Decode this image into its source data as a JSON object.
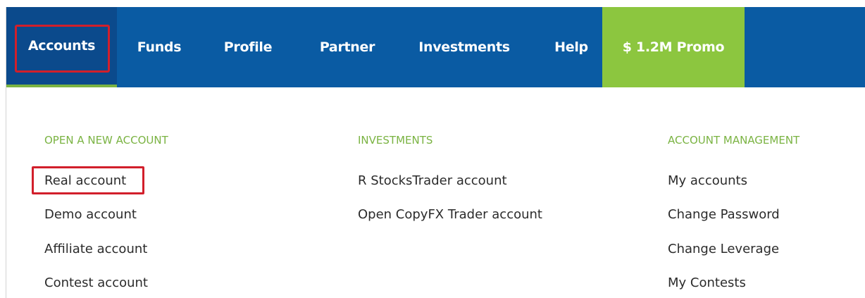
{
  "nav": {
    "items": [
      {
        "label": "Accounts"
      },
      {
        "label": "Funds"
      },
      {
        "label": "Profile"
      },
      {
        "label": "Partner"
      },
      {
        "label": "Investments"
      },
      {
        "label": "Help"
      },
      {
        "label": "$ 1.2M Promo"
      }
    ],
    "active": "Accounts",
    "colors": {
      "bar": "#0a5ba3",
      "active_bg": "#0b4a8c",
      "promo_bg": "#8cc63f",
      "accent": "#7ab342",
      "highlight": "#d21f2b"
    }
  },
  "dropdown": {
    "columns": [
      {
        "heading": "OPEN A NEW ACCOUNT",
        "links": [
          "Real account",
          "Demo account",
          "Affiliate account",
          "Contest account"
        ]
      },
      {
        "heading": "INVESTMENTS",
        "links": [
          "R StocksTrader account",
          "Open CopyFX Trader account"
        ]
      },
      {
        "heading": "ACCOUNT MANAGEMENT",
        "links": [
          "My accounts",
          "Change Password",
          "Change Leverage",
          "My Contests"
        ]
      }
    ]
  }
}
